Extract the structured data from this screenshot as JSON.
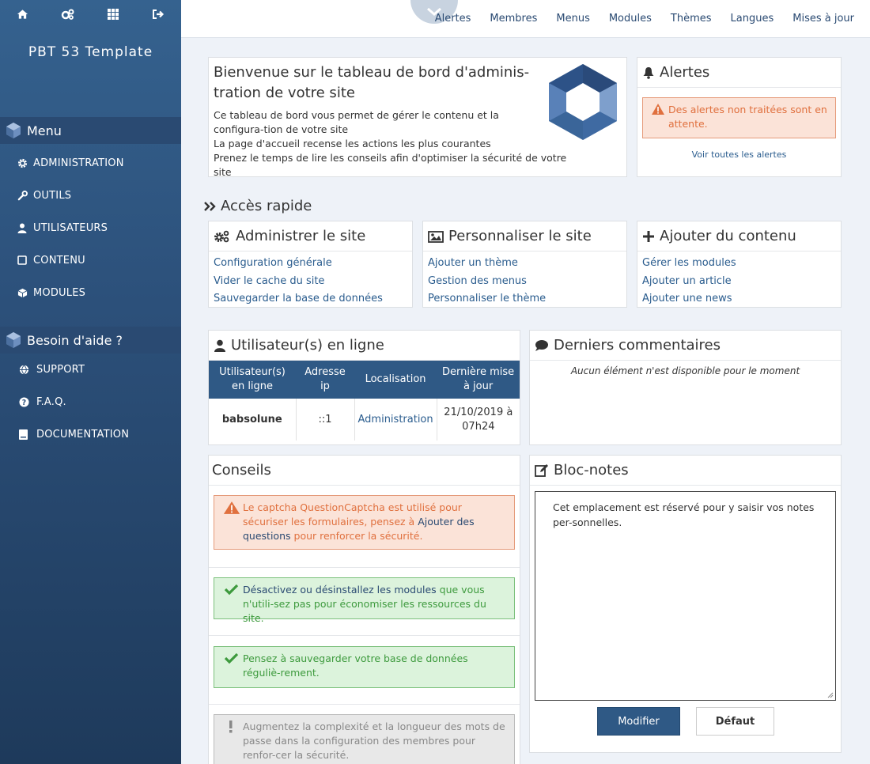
{
  "sidebar": {
    "site_title": "PBT 53 Template",
    "menu_title": "Menu",
    "menu_items": [
      "ADMINISTRATION",
      "OUTILS",
      "UTILISATEURS",
      "CONTENU",
      "MODULES"
    ],
    "help_title": "Besoin d'aide ?",
    "help_items": [
      "SUPPORT",
      "F.A.Q.",
      "DOCUMENTATION"
    ]
  },
  "topnav": [
    "Alertes",
    "Membres",
    "Menus",
    "Modules",
    "Thèmes",
    "Langues",
    "Mises à jour"
  ],
  "welcome": {
    "title": "Bienvenue sur le tableau de bord d'adminis-tration de votre site",
    "lines": [
      "Ce tableau de bord vous permet de gérer le contenu et la configura-tion de votre site",
      "La page d'accueil recense les actions les plus courantes",
      "Prenez le temps de lire les conseils afin d'optimiser la sécurité de votre site"
    ]
  },
  "alerts": {
    "title": "Alertes",
    "message": "Des alertes non traitées sont en attente.",
    "see_all": "Voir toutes les alertes"
  },
  "quick_access": {
    "title": "Accès rapide",
    "admin": {
      "title": "Administrer le site",
      "links": [
        "Configuration générale",
        "Vider le cache du site",
        "Sauvegarder la base de données"
      ]
    },
    "custom": {
      "title": "Personnaliser le site",
      "links": [
        "Ajouter un thème",
        "Gestion des menus",
        "Personnaliser le thème"
      ]
    },
    "content": {
      "title": "Ajouter du contenu",
      "links": [
        "Gérer les modules",
        "Ajouter un article",
        "Ajouter une news"
      ]
    }
  },
  "online": {
    "title": "Utilisateur(s) en ligne",
    "headers": [
      "Utilisateur(s) en ligne",
      "Adresse ip",
      "Localisation",
      "Dernière mise à jour"
    ],
    "rows": [
      [
        "babsolune",
        "::1",
        "Administration",
        "21/10/2019 à 07h24"
      ]
    ]
  },
  "comments": {
    "title": "Derniers commentaires",
    "empty": "Aucun élément n'est disponible pour le moment"
  },
  "tips": {
    "title": "Conseils",
    "warn_pre": "Le captcha QuestionCaptcha est utilisé pour sécuriser les formulaires, pensez à ",
    "warn_link": "Ajouter des questions",
    "warn_post": " pour renforcer la sécurité.",
    "ok1_link": "Désactivez ou désinstallez les modules",
    "ok1_post": " que vous n'utili-sez pas pour économiser les ressources du site.",
    "ok2": "Pensez à sauvegarder votre base de données réguliè-rement.",
    "info": "Augmentez la complexité et la longueur des mots de passe dans la configuration des membres pour renfor-cer la sécurité."
  },
  "notepad": {
    "title": "Bloc-notes",
    "text": "Cet emplacement est réservé pour y saisir vos notes per-sonnelles.",
    "modify": "Modifier",
    "default": "Défaut"
  },
  "colors": {
    "sidebar": "#2c507a",
    "accent": "#2f5985",
    "warn": "#e0703e",
    "ok": "#3d9a3d"
  }
}
